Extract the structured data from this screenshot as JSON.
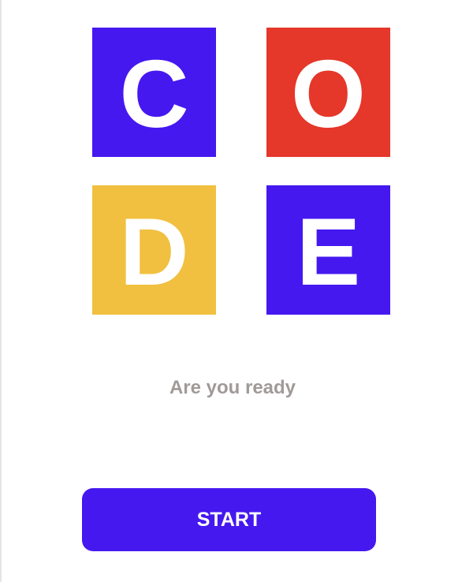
{
  "logo": {
    "tiles": [
      {
        "letter": "C",
        "color": "#4518F0"
      },
      {
        "letter": "O",
        "color": "#E5372A"
      },
      {
        "letter": "D",
        "color": "#F1C040"
      },
      {
        "letter": "E",
        "color": "#4518F0"
      }
    ]
  },
  "prompt": {
    "text": "Are you ready"
  },
  "start_button": {
    "label": "START",
    "color": "#4518F0"
  }
}
